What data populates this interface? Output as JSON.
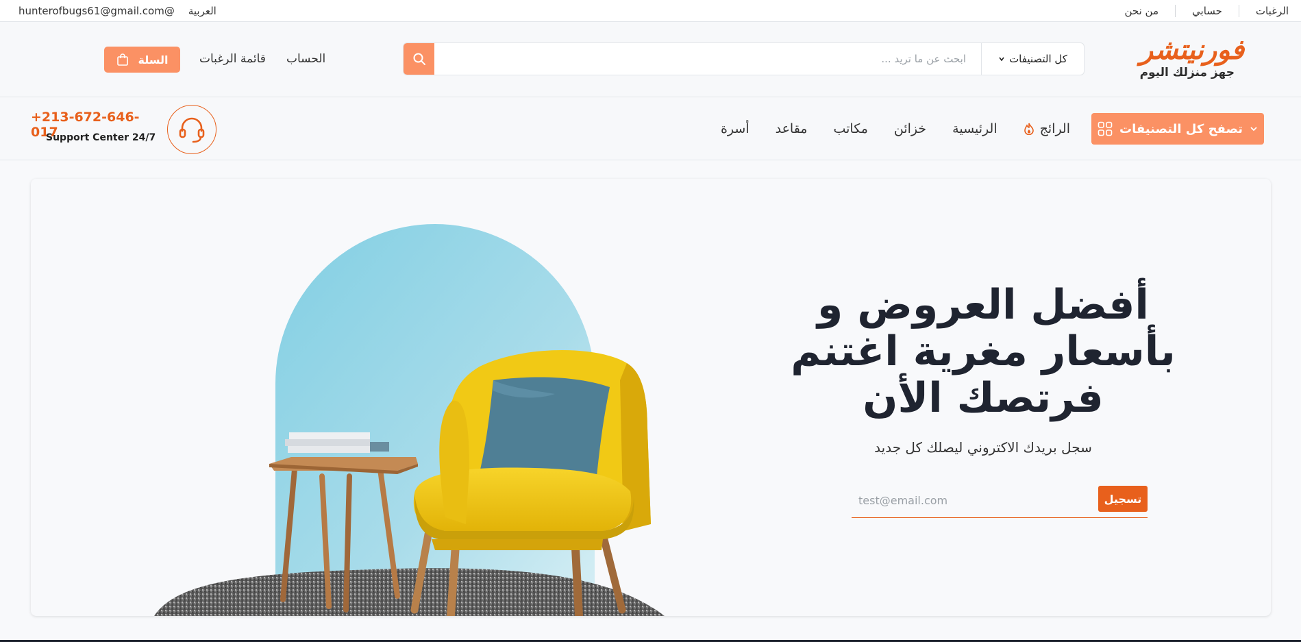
{
  "topbar": {
    "right_links": [
      "الرغبات",
      "حسابي",
      "من نحن"
    ],
    "language": "العربية",
    "email": "hunterofbugs61@gmail.com@"
  },
  "header": {
    "brand": "فورنيتشر",
    "tagline": "جهز منزلك اليوم",
    "search": {
      "placeholder": "ابحث عن ما تريد ...",
      "category": "كل التصنيفات"
    },
    "account": "الحساب",
    "wishlist": "قائمة الرغبات",
    "cart": "السلة"
  },
  "nav": {
    "browse": "تصفح كل التصنيفات",
    "items": [
      "الرائج",
      "الرئيسية",
      "خزائن",
      "مكاتب",
      "مقاعد",
      "أسرة"
    ],
    "phone": "+213-672-646-017",
    "support": "Support Center 24/7"
  },
  "hero": {
    "title_lines": [
      "أفضل العروض و",
      "بأسعار مغرية اغتنم",
      "فرتصك الأن"
    ],
    "subtitle": "سجل بريدك الاكتروني ليصلك كل جديد",
    "email_placeholder": "test@email.com",
    "subscribe": "تسجيل"
  },
  "colors": {
    "accent": "#e8601c",
    "accent_light": "#fb9164",
    "text_dark": "#1f2430",
    "arch_blue": "#8fd3e6",
    "chair_yellow": "#f3c614"
  }
}
